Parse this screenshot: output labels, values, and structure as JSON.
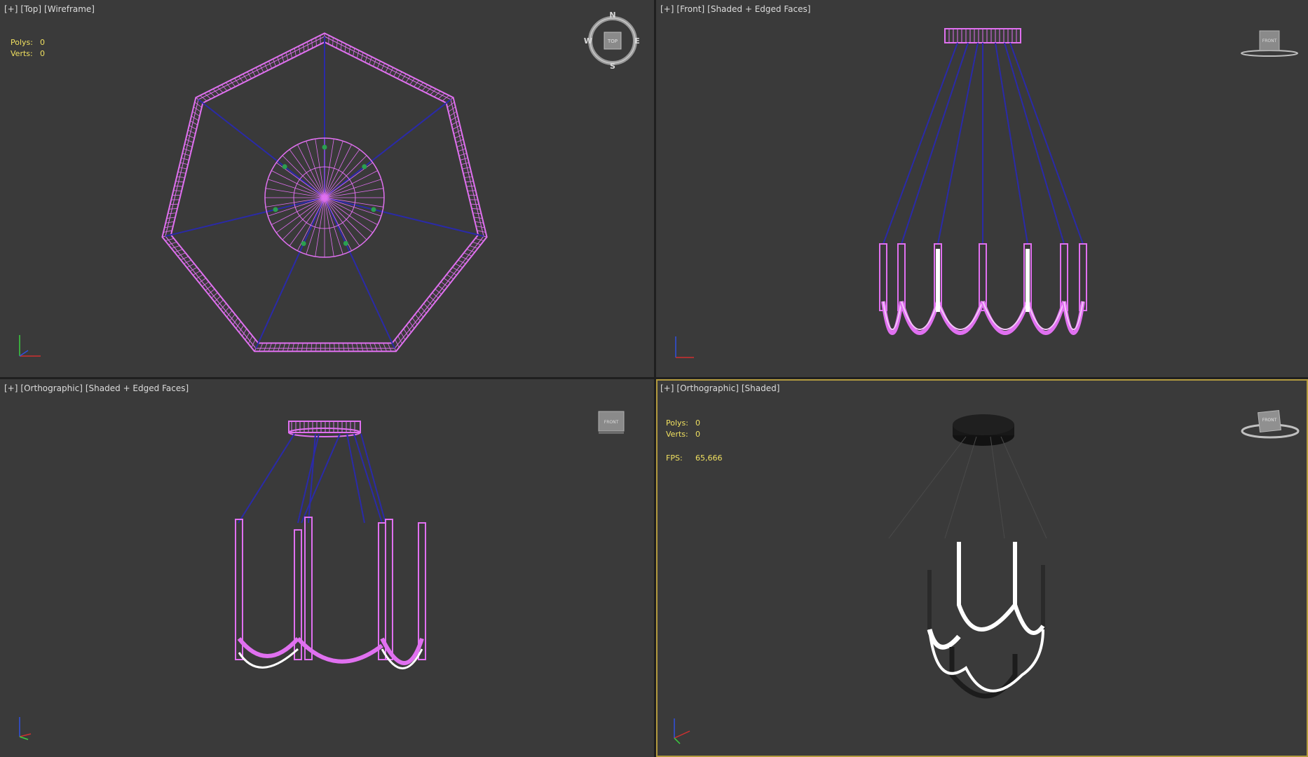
{
  "viewports": {
    "top": {
      "labels": [
        "[+]",
        "[Top]",
        "[Wireframe]"
      ],
      "stats": {
        "polys_label": "Polys:",
        "polys": "0",
        "verts_label": "Verts:",
        "verts": "0"
      },
      "compass": {
        "n": "N",
        "s": "S",
        "e": "E",
        "w": "W",
        "cube_face": "TOP"
      }
    },
    "front": {
      "labels": [
        "[+]",
        "[Front]",
        "[Shaded + Edged Faces]"
      ],
      "cube_face": "FRONT"
    },
    "ortho_edged": {
      "labels": [
        "[+]",
        "[Orthographic]",
        "[Shaded + Edged Faces]"
      ],
      "cube_face": "FRONT"
    },
    "ortho_shaded": {
      "labels": [
        "[+]",
        "[Orthographic]",
        "[Shaded]"
      ],
      "stats": {
        "polys_label": "Polys:",
        "polys": "0",
        "verts_label": "Verts:",
        "verts": "0",
        "fps_label": "FPS:",
        "fps": "65,666"
      },
      "cube_face": "FRONT",
      "active": true
    }
  },
  "colors": {
    "viewport_bg": "#3a3a3a",
    "wire_magenta": "#e070f0",
    "wire_blue": "#2a2aa8",
    "pivot_green": "#2aa050",
    "stats_yellow": "#f0e060",
    "active_border": "#b39b3f"
  }
}
